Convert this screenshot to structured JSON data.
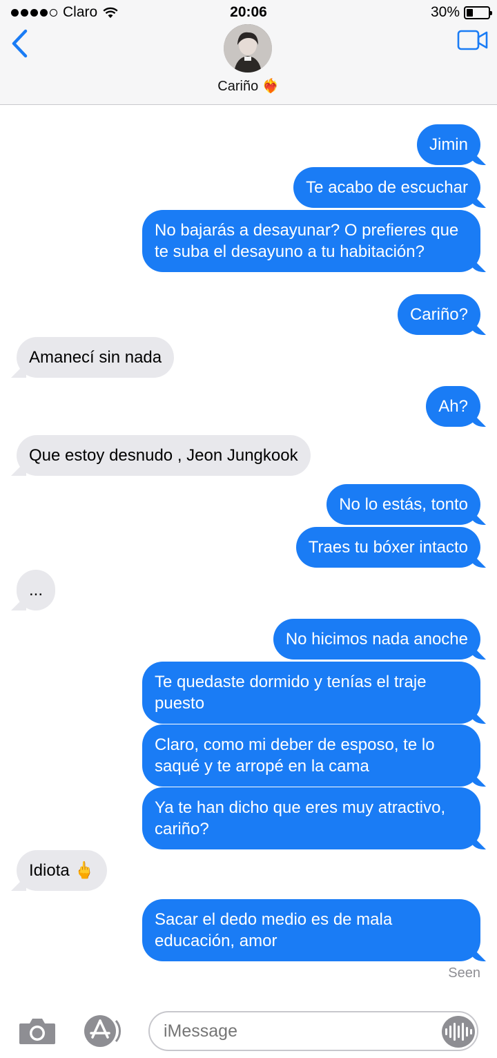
{
  "status": {
    "carrier": "Claro",
    "time": "20:06",
    "battery": "30%",
    "battery_level": 0.3
  },
  "header": {
    "contact_name": "Cariño",
    "contact_emoji": "❤️‍🔥",
    "back_icon": "chevron-left-icon",
    "video_icon": "video-camera-icon"
  },
  "messages": [
    {
      "dir": "out",
      "text": "Jimin"
    },
    {
      "dir": "out",
      "text": "Te acabo de escuchar"
    },
    {
      "dir": "out",
      "text": "No bajarás a desayunar? O prefieres que te suba el desayuno a tu habitación?"
    },
    {
      "dir": "out",
      "text": "Cariño?"
    },
    {
      "dir": "in",
      "text": "Amanecí sin nada"
    },
    {
      "dir": "out",
      "text": "Ah?"
    },
    {
      "dir": "in",
      "text": "Que estoy desnudo , Jeon Jungkook"
    },
    {
      "dir": "out",
      "text": "No lo estás, tonto"
    },
    {
      "dir": "out",
      "text": "Traes tu bóxer intacto"
    },
    {
      "dir": "in",
      "text": "..."
    },
    {
      "dir": "out",
      "text": "No hicimos nada anoche"
    },
    {
      "dir": "out",
      "text": "Te quedaste dormido y tenías el traje puesto"
    },
    {
      "dir": "out",
      "text": "Claro, como mi deber de esposo, te lo saqué y te arropé en la cama"
    },
    {
      "dir": "out",
      "text": "Ya te han dicho que eres muy atractivo, cariño?"
    },
    {
      "dir": "in",
      "text": "Idiota 🖕"
    },
    {
      "dir": "out",
      "text": "Sacar el dedo medio es de mala educación, amor"
    }
  ],
  "seen_label": "Seen",
  "input": {
    "placeholder": "iMessage",
    "camera_icon": "camera-icon",
    "apps_icon": "app-store-icon",
    "audio_icon": "audio-waveform-icon"
  },
  "colors": {
    "outgoing_bubble": "#1a7cf5",
    "incoming_bubble": "#e8e8ec",
    "accent": "#1a7cf5"
  }
}
